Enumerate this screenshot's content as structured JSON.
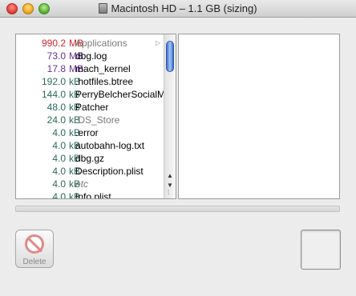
{
  "window": {
    "title": "Macintosh HD – 1.1 GB (sizing)"
  },
  "file_list": {
    "rows": [
      {
        "size": "990.2",
        "unit": "MB",
        "name": "Applications",
        "color": "#d4242c"
      },
      {
        "size": "73.0",
        "unit": "MB",
        "name": "dbg.log",
        "color": "#6a2d9c"
      },
      {
        "size": "17.8",
        "unit": "MB",
        "name": "mach_kernel",
        "color": "#6a2d9c"
      },
      {
        "size": "192.0",
        "unit": "kB",
        "name": ".hotfiles.btree",
        "color": "#2a6a5a"
      },
      {
        "size": "144.0",
        "unit": "kB",
        "name": "PerryBelcherSocialM",
        "color": "#2a6a5a"
      },
      {
        "size": "48.0",
        "unit": "kB",
        "name": "Patcher",
        "color": "#2a6a5a"
      },
      {
        "size": "24.0",
        "unit": "kB",
        "name": ".DS_Store",
        "color": "#2a6a5a"
      },
      {
        "size": "4.0",
        "unit": "kB",
        "name": ".error",
        "color": "#2a6a5a"
      },
      {
        "size": "4.0",
        "unit": "kB",
        "name": "autobahn-log.txt",
        "color": "#2a6a5a"
      },
      {
        "size": "4.0",
        "unit": "kB",
        "name": "dbg.gz",
        "color": "#2a6a5a"
      },
      {
        "size": "4.0",
        "unit": "kB",
        "name": "Description.plist",
        "color": "#2a6a5a"
      },
      {
        "size": "4.0",
        "unit": "kB",
        "name": "etc",
        "color": "#2a6a5a"
      },
      {
        "size": "4.0",
        "unit": "kB",
        "name": "Info.plist",
        "color": "#2a6a5a"
      }
    ]
  },
  "actions": {
    "delete_label": "Delete"
  }
}
